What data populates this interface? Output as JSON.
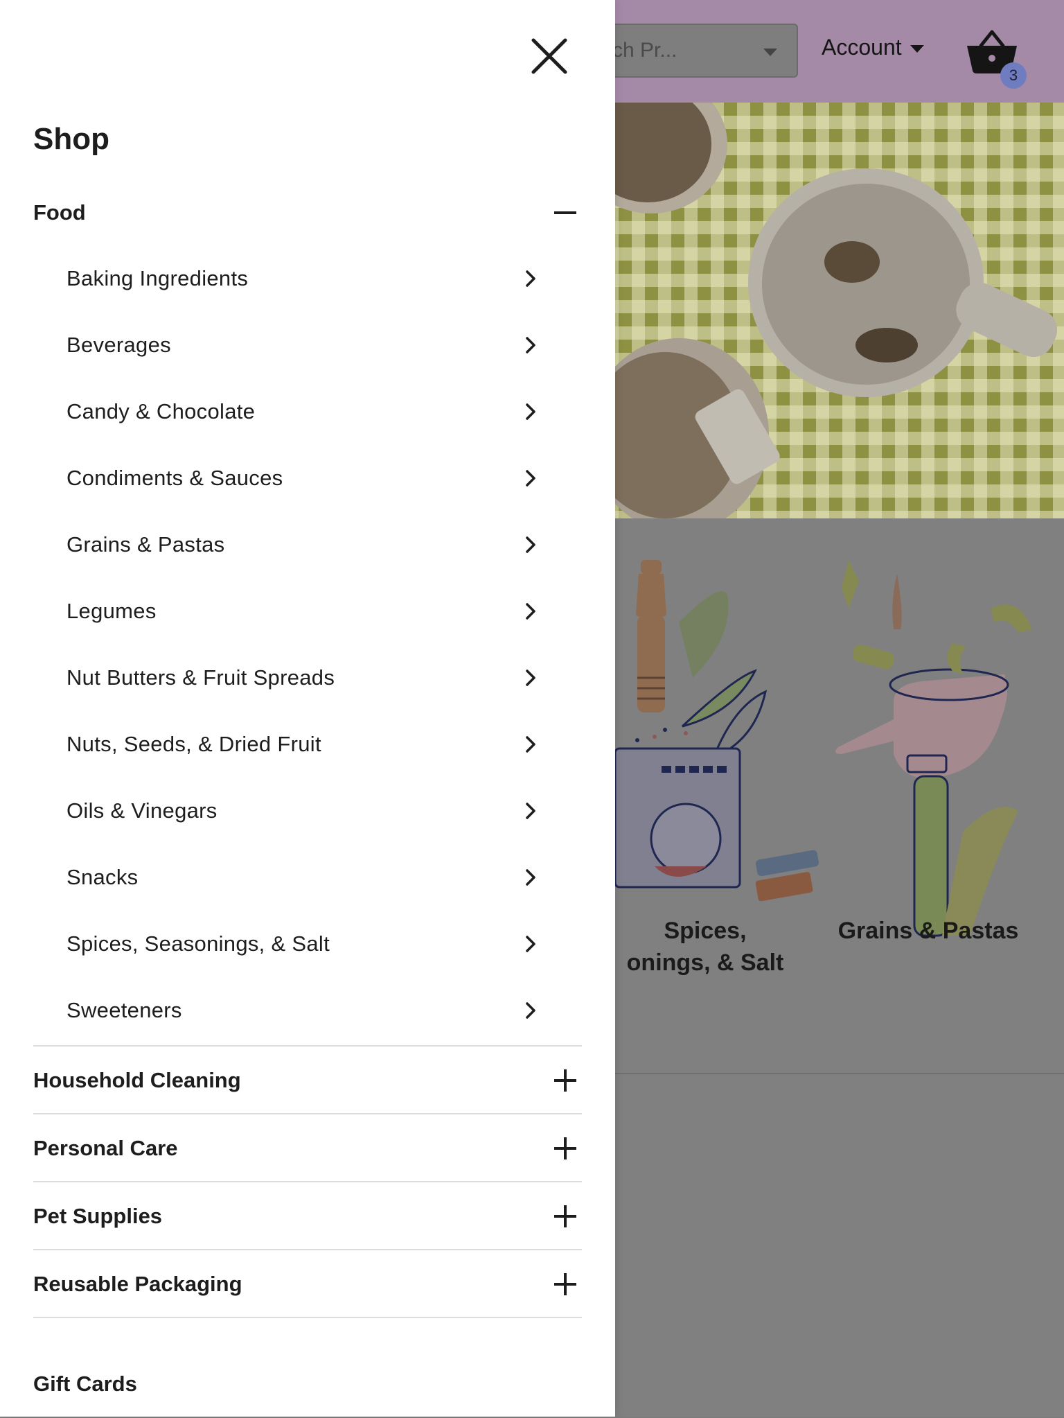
{
  "header": {
    "search_placeholder": "rch Pr...",
    "account_label": "Account",
    "cart_count": "3"
  },
  "background": {
    "categories": [
      {
        "label_line1": "Spices,",
        "label_line2": "onings, & Salt"
      },
      {
        "label_line1": "Grains & Pastas",
        "label_line2": ""
      }
    ]
  },
  "drawer": {
    "title": "Shop",
    "food": {
      "label": "Food",
      "expanded": true,
      "items": [
        {
          "label": "Baking Ingredients"
        },
        {
          "label": "Beverages"
        },
        {
          "label": "Candy & Chocolate"
        },
        {
          "label": "Condiments & Sauces"
        },
        {
          "label": "Grains & Pastas"
        },
        {
          "label": "Legumes"
        },
        {
          "label": "Nut Butters & Fruit Spreads"
        },
        {
          "label": "Nuts, Seeds, & Dried Fruit"
        },
        {
          "label": "Oils & Vinegars"
        },
        {
          "label": "Snacks"
        },
        {
          "label": "Spices, Seasonings, & Salt"
        },
        {
          "label": "Sweeteners"
        }
      ]
    },
    "sections": [
      {
        "label": "Household Cleaning"
      },
      {
        "label": "Personal Care"
      },
      {
        "label": "Pet Supplies"
      },
      {
        "label": "Reusable Packaging"
      }
    ],
    "gift_cards_label": "Gift Cards"
  },
  "colors": {
    "overlay": "#7d7d7d",
    "header_bg": "#a58aa8",
    "badge": "#6f7cc0",
    "text": "#1d1d1d"
  }
}
